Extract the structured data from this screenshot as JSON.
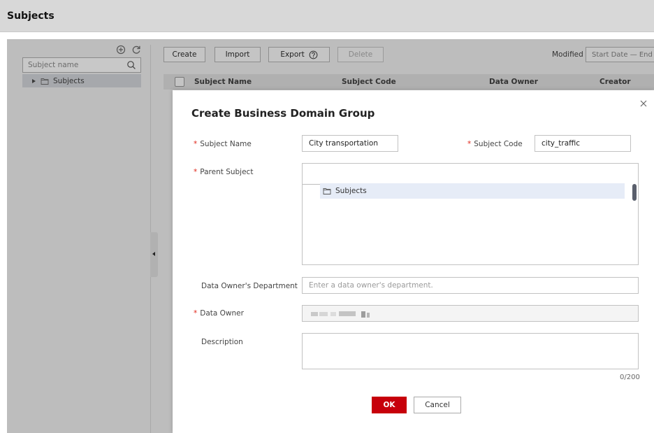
{
  "page": {
    "title": "Subjects"
  },
  "sidebar": {
    "search_placeholder": "Subject name",
    "tree": [
      {
        "label": "Subjects"
      }
    ],
    "icons": {
      "add": "plus-circle-icon",
      "refresh": "refresh-icon",
      "search": "search-icon",
      "folder": "folder-icon"
    }
  },
  "toolbar": {
    "create_label": "Create",
    "import_label": "Import",
    "export_label": "Export",
    "delete_label": "Delete",
    "modified_label": "Modified",
    "date_range_placeholder": "Start Date — End Date"
  },
  "table": {
    "columns": [
      "Subject Name",
      "Subject Code",
      "Data Owner",
      "Creator"
    ]
  },
  "dialog": {
    "title": "Create Business Domain Group",
    "fields": {
      "subject_name": {
        "label": "Subject Name",
        "value": "City transportation",
        "required": true
      },
      "subject_code": {
        "label": "Subject Code",
        "value": "city_traffic",
        "required": true
      },
      "parent_subject": {
        "label": "Parent Subject",
        "required": true,
        "tree": [
          {
            "label": "Subjects"
          }
        ]
      },
      "department": {
        "label": "Data Owner's Department",
        "placeholder": "Enter a data owner's department.",
        "required": false
      },
      "data_owner": {
        "label": "Data Owner",
        "required": true
      },
      "description": {
        "label": "Description",
        "required": false,
        "counter": "0/200"
      }
    },
    "ok_label": "OK",
    "cancel_label": "Cancel",
    "required_mark": "*"
  },
  "colors": {
    "accent": "#c7000b",
    "required": "#e0271a",
    "overlay": "#bdbdbd",
    "tree_selected": "#e6ecf7"
  }
}
